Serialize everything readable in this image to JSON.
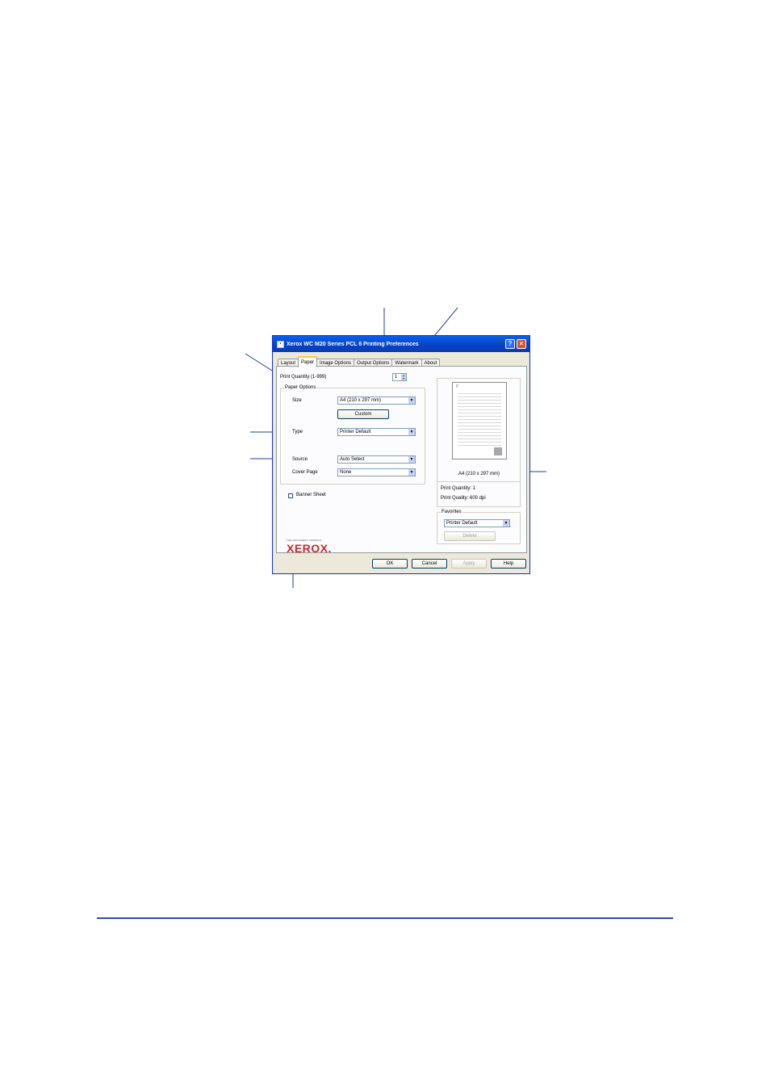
{
  "window": {
    "title": "Xerox WC M20 Series PCL 6 Printing Preferences",
    "help_glyph": "?",
    "close_glyph": "×"
  },
  "tabs": [
    {
      "label": "Layout",
      "active": false
    },
    {
      "label": "Paper",
      "active": true
    },
    {
      "label": "Image Options",
      "active": false
    },
    {
      "label": "Output Options",
      "active": false
    },
    {
      "label": "Watermark",
      "active": false
    },
    {
      "label": "About",
      "active": false
    }
  ],
  "paper_tab": {
    "print_quantity_label": "Print Quantity (1-999)",
    "print_quantity_value": "1",
    "paper_options_title": "Paper Options",
    "size_label": "Size",
    "size_value": "A4 (210 x 297 mm)",
    "custom_button": "Custom",
    "type_label": "Type",
    "type_value": "Printer Default",
    "source_label": "Source",
    "source_value": "Auto Select",
    "cover_page_label": "Cover Page",
    "cover_page_value": "None",
    "banner_sheet_label": "Banner Sheet",
    "banner_sheet_checked": false,
    "dropdown_glyph": "▼",
    "spin_up_glyph": "▲",
    "spin_down_glyph": "▼"
  },
  "preview": {
    "page_size": "A4 (210 x 297 mm)",
    "print_quantity": "Print Quantity: 1",
    "print_quality": "Print Quality: 600 dpi",
    "page_glyph": "P"
  },
  "favorites": {
    "title": "Favorites",
    "value": "Printer Default",
    "delete_button": "Delete"
  },
  "brand": {
    "tagline": "THE DOCUMENT COMPANY",
    "logo": "XEROX."
  },
  "buttons": {
    "ok": "OK",
    "cancel": "Cancel",
    "apply": "Apply",
    "help": "Help"
  },
  "colors": {
    "accent": "#2b4fb0",
    "titlebar": "#0841c4",
    "brand_red": "#d0262e",
    "leader_lines": "#1f3f8f"
  }
}
